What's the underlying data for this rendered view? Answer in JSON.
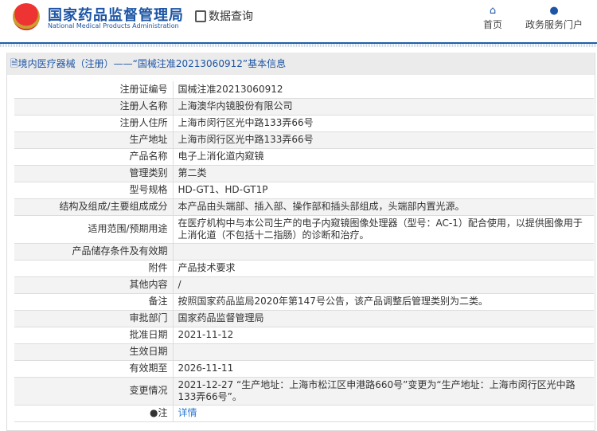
{
  "header": {
    "logo_cn": "国家药品监督管理局",
    "logo_en": "National Medical Products Administration",
    "query": "数据查询",
    "nav": [
      {
        "icon": "home-icon",
        "label": "首页"
      },
      {
        "icon": "user-icon",
        "label": "政务服务门户"
      }
    ]
  },
  "panel": {
    "title": "境内医疗器械（注册）——“国械注准20213060912”基本信息"
  },
  "rows": [
    {
      "label": "注册证编号",
      "value": "国械注准20213060912"
    },
    {
      "label": "注册人名称",
      "value": "上海澳华内镜股份有限公司"
    },
    {
      "label": "注册人住所",
      "value": "上海市闵行区光中路133弄66号"
    },
    {
      "label": "生产地址",
      "value": "上海市闵行区光中路133弄66号"
    },
    {
      "label": "产品名称",
      "value": "电子上消化道内窥镜"
    },
    {
      "label": "管理类别",
      "value": "第二类"
    },
    {
      "label": "型号规格",
      "value": "HD-GT1、HD-GT1P"
    },
    {
      "label": "结构及组成/主要组成成分",
      "value": "本产品由头端部、插入部、操作部和插头部组成，头端部内置光源。"
    },
    {
      "label": "适用范围/预期用途",
      "value": "在医疗机构中与本公司生产的电子内窥镜图像处理器（型号：AC-1）配合使用，以提供图像用于上消化道（不包括十二指肠）的诊断和治疗。"
    },
    {
      "label": "产品储存条件及有效期",
      "value": ""
    },
    {
      "label": "附件",
      "value": "产品技术要求"
    },
    {
      "label": "其他内容",
      "value": "/"
    },
    {
      "label": "备注",
      "value": "按照国家药品监局2020年第147号公告，该产品调整后管理类别为二类。"
    },
    {
      "label": "审批部门",
      "value": "国家药品监督管理局"
    },
    {
      "label": "批准日期",
      "value": "2021-11-12"
    },
    {
      "label": "生效日期",
      "value": ""
    },
    {
      "label": "有效期至",
      "value": "2026-11-11"
    },
    {
      "label": "变更情况",
      "value": "2021-12-27 “生产地址：上海市松江区申港路660号”变更为“生产地址：上海市闵行区光中路133弄66号”。"
    }
  ],
  "note": {
    "label": "注",
    "link": "详情"
  }
}
